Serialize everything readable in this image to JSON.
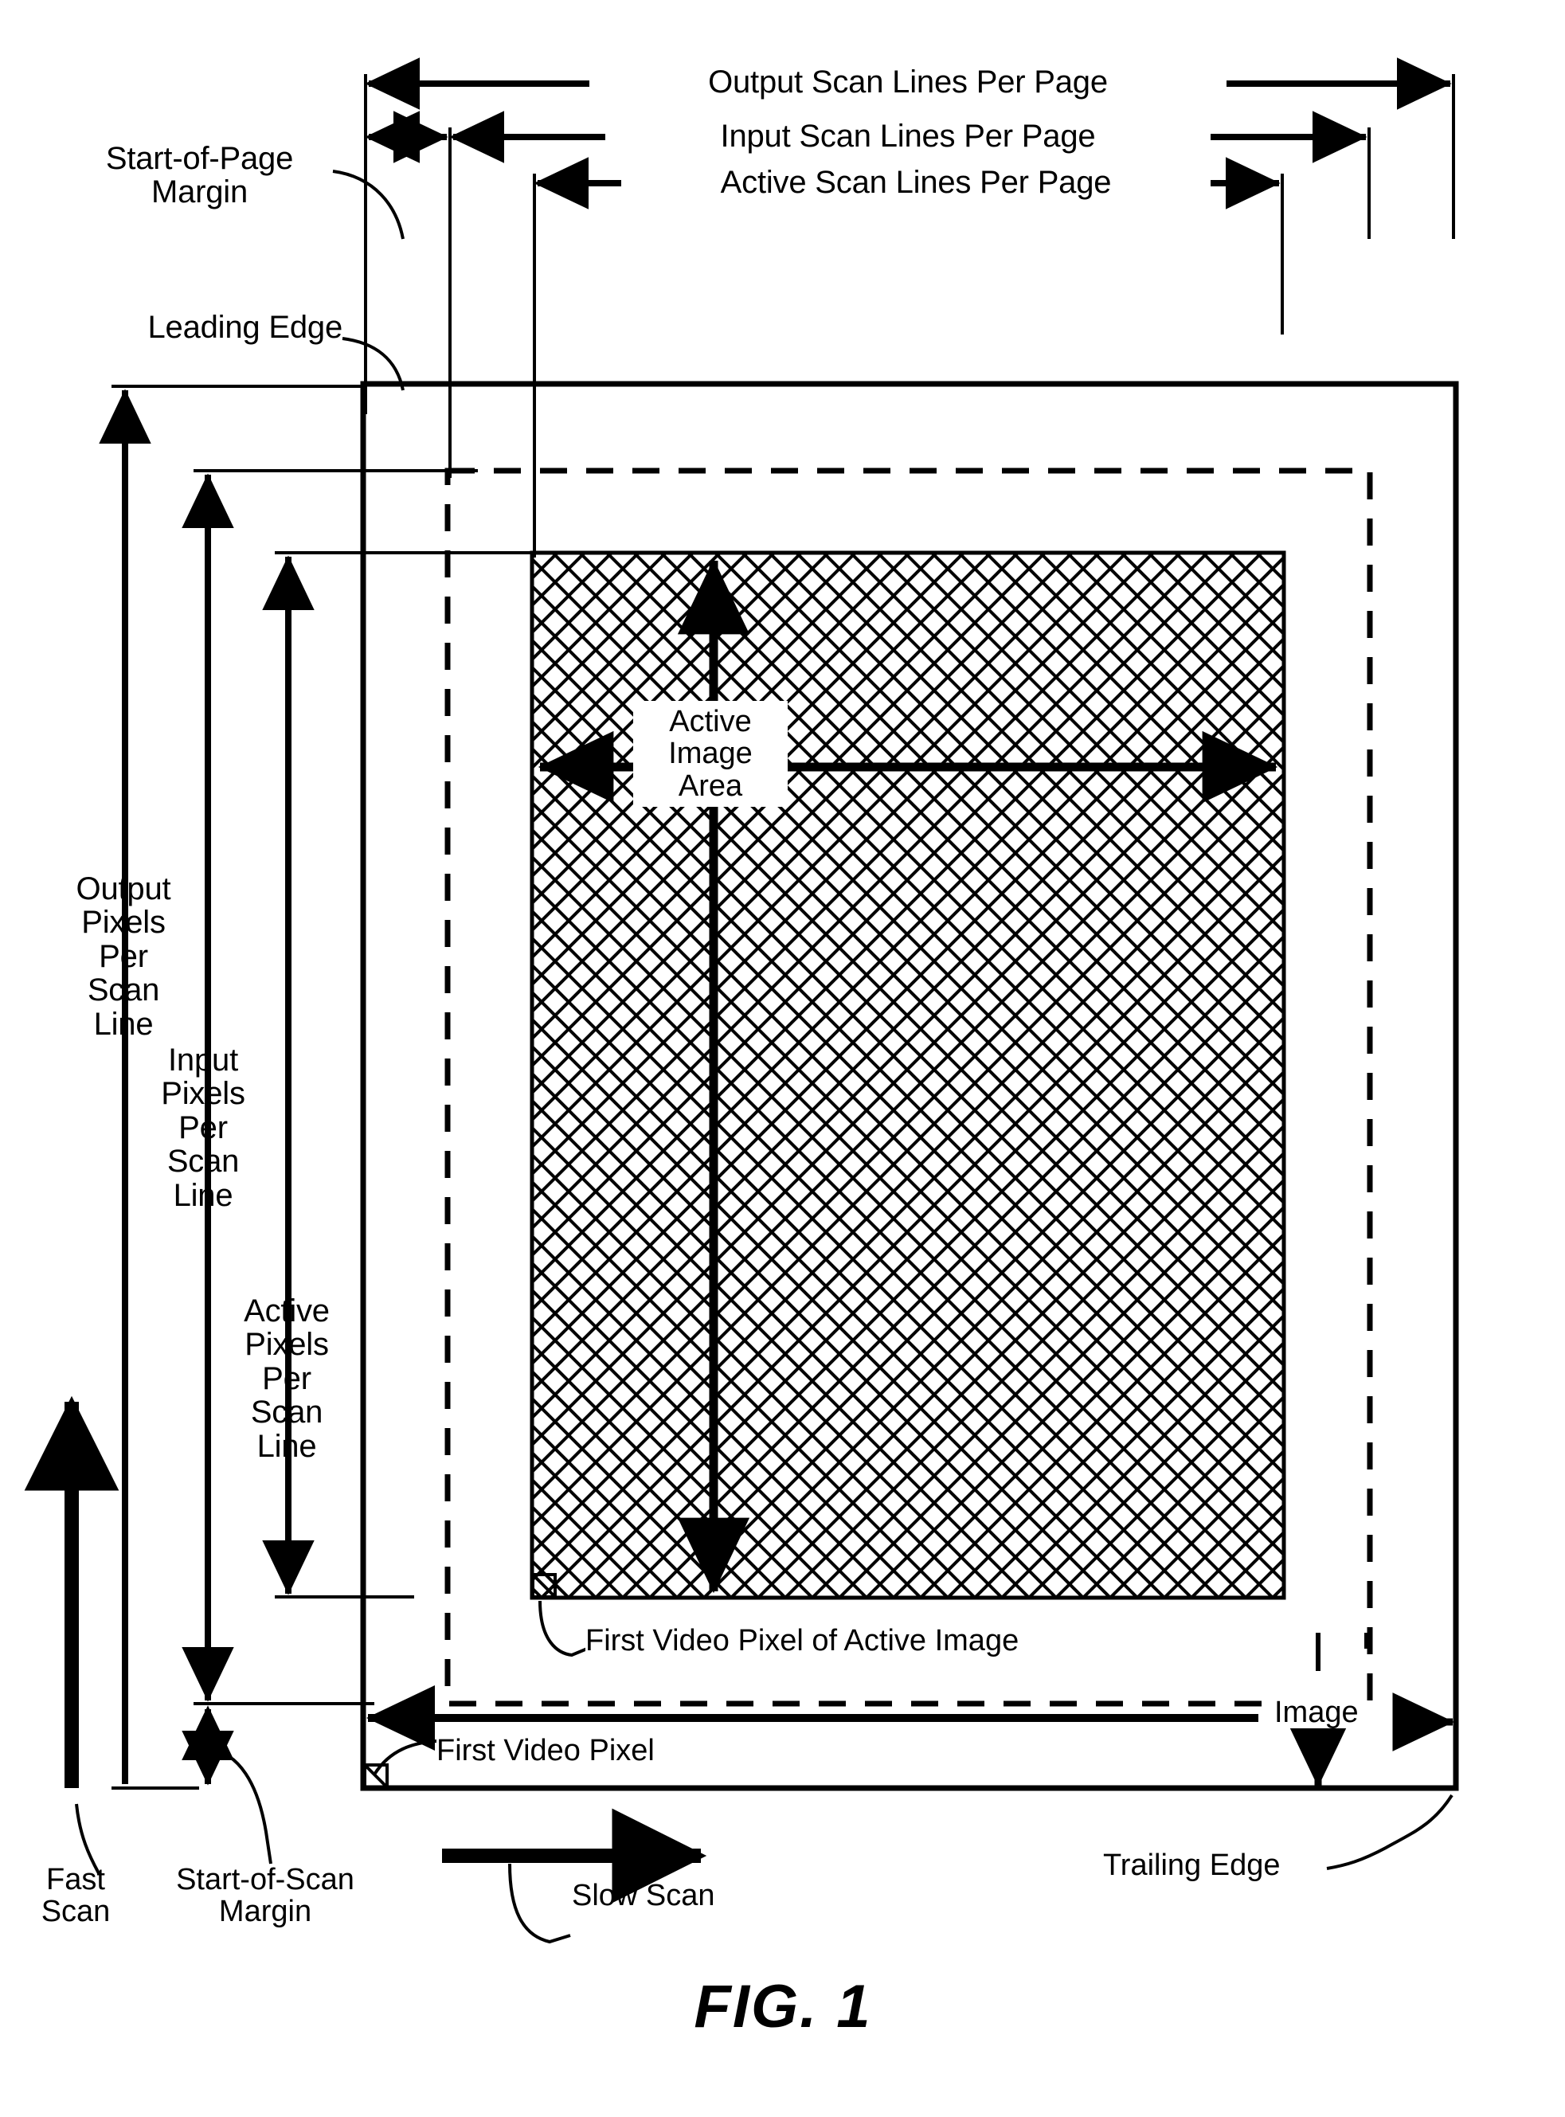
{
  "figure": {
    "caption": "FIG. 1",
    "type": "patent-line-drawing",
    "description": "Scan geometry diagram showing page, image and active image areas"
  },
  "horizontal_dimensions": [
    {
      "id": "output-scan-lines-per-page",
      "label": "Output Scan Lines Per Page"
    },
    {
      "id": "input-scan-lines-per-page",
      "label": "Input Scan Lines Per Page"
    },
    {
      "id": "active-scan-lines-per-page",
      "label": "Active Scan Lines Per Page"
    }
  ],
  "vertical_dimensions": [
    {
      "id": "output-pixels-per-scan-line",
      "label": "Output\nPixels\nPer\nScan\nLine"
    },
    {
      "id": "input-pixels-per-scan-line",
      "label": "Input\nPixels\nPer\nScan\nLine"
    },
    {
      "id": "active-pixels-per-scan-line",
      "label": "Active\nPixels\nPer\nScan\nLine"
    }
  ],
  "callouts": {
    "start_of_page_margin": "Start-of-Page\nMargin",
    "leading_edge": "Leading Edge",
    "trailing_edge": "Trailing Edge",
    "start_of_scan_margin": "Start-of-Scan\nMargin",
    "fast_scan": "Fast\nScan",
    "slow_scan": "Slow Scan",
    "first_video_pixel": "First Video Pixel",
    "first_video_pixel_of_active_image": "First Video Pixel of Active Image",
    "image": "Image",
    "active_image_area": "Active\nImage\nArea"
  },
  "regions": {
    "page_outline": "Output page area (solid rectangle)",
    "image_outline": "Image area (dashed rectangle)",
    "active_image": "Active image area (cross-hatched rectangle)"
  },
  "colors": {
    "ink": "#000000",
    "paper": "#ffffff"
  }
}
